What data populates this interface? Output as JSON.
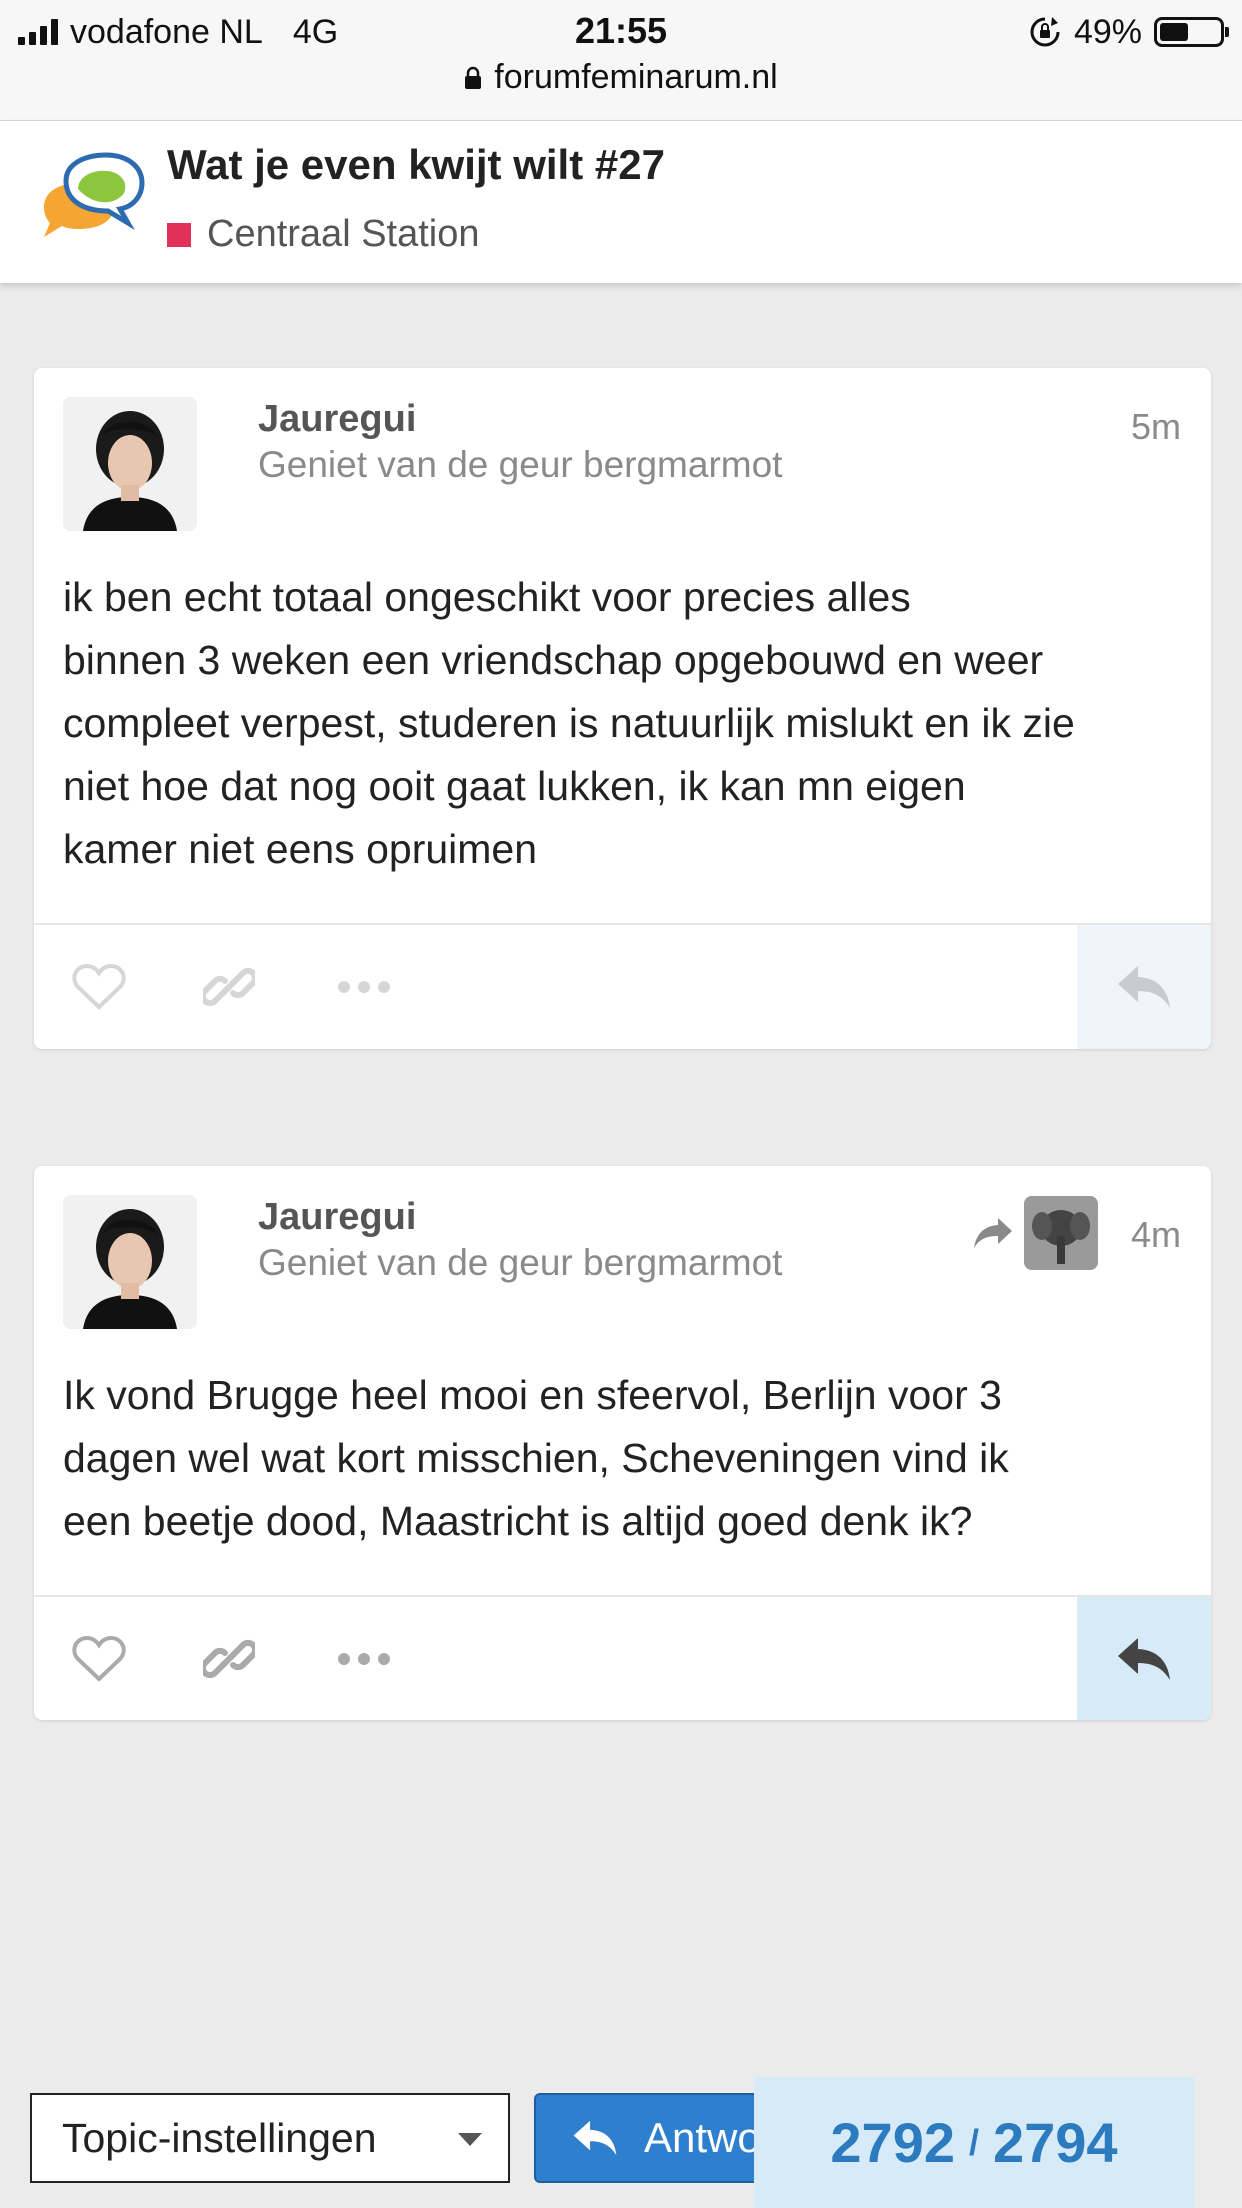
{
  "status_bar": {
    "carrier": "vodafone NL",
    "network": "4G",
    "time": "21:55",
    "battery_percent": "49%",
    "battery_level": 0.49,
    "url": "forumfeminarum.nl"
  },
  "header": {
    "topic_title": "Wat je even kwijt wilt #27",
    "category": "Centraal Station",
    "category_color": "#e1305a"
  },
  "posts": [
    {
      "username": "Jauregui",
      "user_title": "Geniet van de geur bergmarmot",
      "age": "5m",
      "body": "ik ben echt totaal ongeschikt voor precies alles binnen 3 weken een vriendschap opgebouwd en weer compleet verpest, studeren is natuurlijk mislukt en ik zie niet hoe dat nog ooit gaat lukken, ik kan mn eigen kamer niet eens opruimen",
      "body_lines": [
        "ik ben echt totaal ongeschikt voor precies alles",
        "binnen 3 weken een vriendschap opgebouwd en weer",
        "compleet verpest, studeren is natuurlijk mislukt en ik zie",
        "niet hoe dat nog ooit gaat lukken, ik kan mn eigen",
        "kamer niet eens opruimen"
      ]
    },
    {
      "username": "Jauregui",
      "user_title": "Geniet van de geur bergmarmot",
      "age": "4m",
      "body_lines": [
        "Ik vond Brugge heel mooi en sfeervol, Berlijn voor 3",
        "dagen wel wat kort misschien, Scheveningen vind ik",
        "een beetje dood, Maastricht is altijd goed denk ik?"
      ]
    }
  ],
  "footer": {
    "topic_settings_label": "Topic-instellingen",
    "answer_label": "Antwoord",
    "progress_current": "2792",
    "progress_separator": "/",
    "progress_total": "2794"
  },
  "colors": {
    "accent_blue": "#2f7fcf",
    "progress_bg": "#d6eaf8",
    "progress_text": "#2c7bbf"
  },
  "icons": [
    "heart-icon",
    "link-icon",
    "more-icon",
    "reply-icon",
    "share-arrow-icon",
    "padlock-icon",
    "rotation-lock-icon"
  ]
}
